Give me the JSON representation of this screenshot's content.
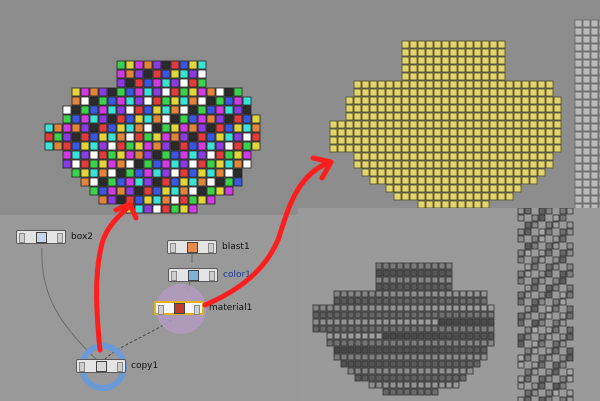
{
  "node_network": {
    "nodes": [
      {
        "name": "box2"
      },
      {
        "name": "blast1"
      },
      {
        "name": "color1"
      },
      {
        "name": "material1"
      },
      {
        "name": "copy1"
      }
    ]
  },
  "colors": {
    "annotation_arrow": "#ff1e1e",
    "voxel_yellow": "#e5d46a",
    "selection": "#e0b21b",
    "copy_ring": "#6b9ad6",
    "material_ring": "#b49ac2"
  }
}
